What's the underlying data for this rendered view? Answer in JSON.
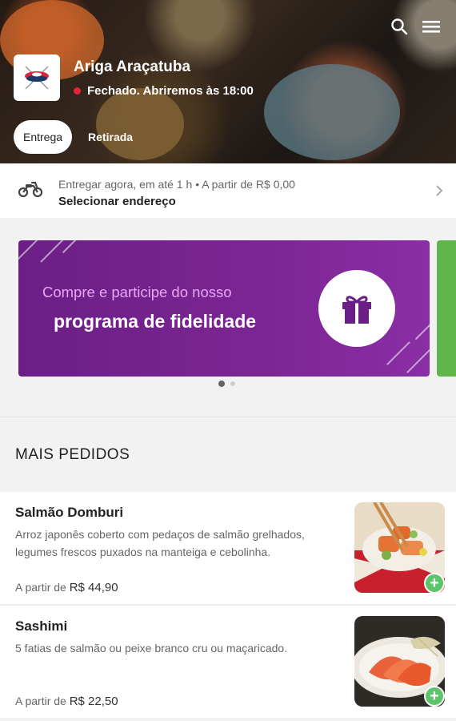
{
  "header": {
    "store_name": "Ariga Araçatuba",
    "status_text": "Fechado. Abriremos às 18:00",
    "status_color": "#e8203a",
    "icons": [
      "search-icon",
      "menu-icon"
    ],
    "tabs": [
      {
        "label": "Entrega",
        "active": true
      },
      {
        "label": "Retirada",
        "active": false
      }
    ]
  },
  "delivery": {
    "info": "Entregar agora, em até 1 h  •  A partir de R$ 0,00",
    "address_cta": "Selecionar endereço",
    "icon": "motorcycle-icon"
  },
  "banner": {
    "line1": "Compre e participe do nosso",
    "line2": "programa de fidelidade",
    "icon": "gift-icon",
    "color": "#7a2593",
    "pages": 2,
    "current_page": 1
  },
  "section": {
    "title": "MAIS PEDIDOS"
  },
  "products": [
    {
      "name": "Salmão Domburi",
      "description": "Arroz japonês coberto com pedaços de salmão grelhados, legumes frescos puxados na manteiga e cebolinha.",
      "price_prefix": "A partir de",
      "price": "R$ 44,90"
    },
    {
      "name": "Sashimi",
      "description": "5 fatias de salmão ou peixe branco cru ou maçaricado.",
      "price_prefix": "A partir de",
      "price": "R$ 22,50"
    }
  ],
  "add_button_label": "+",
  "accent_green": "#5cc46a"
}
